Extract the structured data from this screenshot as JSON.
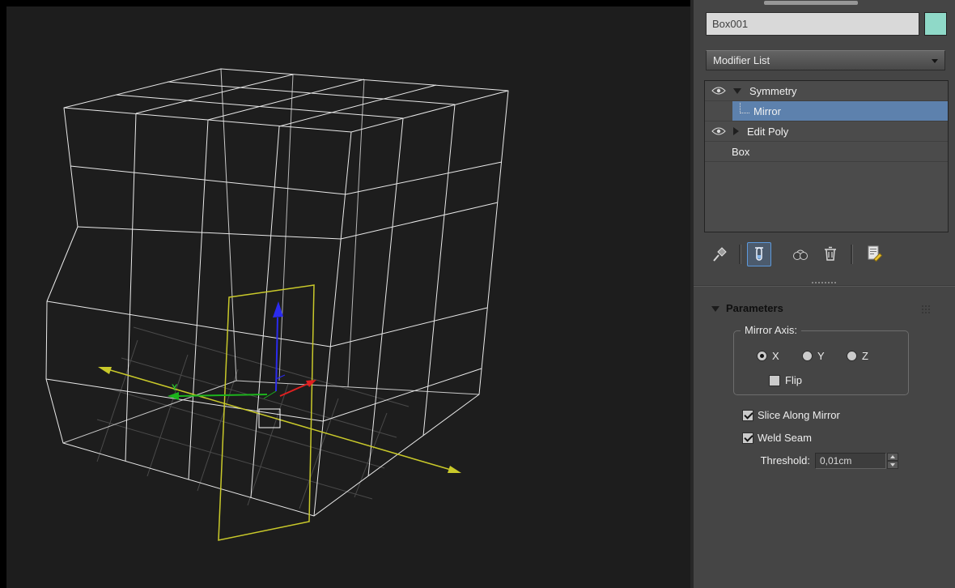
{
  "viewport": {
    "axis_label_y": "Y"
  },
  "command_panel": {
    "object_name_field": {
      "value": "Box001"
    },
    "object_color_swatch": "#8fd9c8",
    "modifier_dropdown": {
      "value": "Modifier List"
    },
    "modifier_stack": {
      "items": [
        {
          "label": "Symmetry"
        },
        {
          "label": "Mirror"
        },
        {
          "label": "Edit Poly"
        },
        {
          "label": "Box"
        }
      ]
    },
    "stack_toolbar": {
      "buttons": [
        "pin-stack-icon",
        "show-end-result-icon",
        "make-unique-icon",
        "remove-modifier-icon",
        "configure-modifier-sets-icon"
      ]
    },
    "parameters_rollout": {
      "title": "Parameters",
      "mirror_axis_group": {
        "title": "Mirror Axis:",
        "options": [
          {
            "label": "X",
            "selected": true
          },
          {
            "label": "Y",
            "selected": false
          },
          {
            "label": "Z",
            "selected": false
          }
        ],
        "flip": {
          "label": "Flip",
          "checked": false
        }
      },
      "slice_along_mirror": {
        "label": "Slice Along Mirror",
        "checked": true
      },
      "weld_seam": {
        "label": "Weld Seam",
        "checked": true
      },
      "threshold": {
        "label": "Threshold:",
        "value": "0,01cm"
      }
    }
  },
  "colors": {
    "panel_bg": "#454545",
    "viewport_bg": "#1d1d1d",
    "selection_blue": "#5d81ad",
    "gizmo_yellow": "#c9c92a",
    "axis_x_red": "#e02020",
    "axis_y_green": "#1db41d",
    "axis_z_blue": "#2b2bee"
  }
}
